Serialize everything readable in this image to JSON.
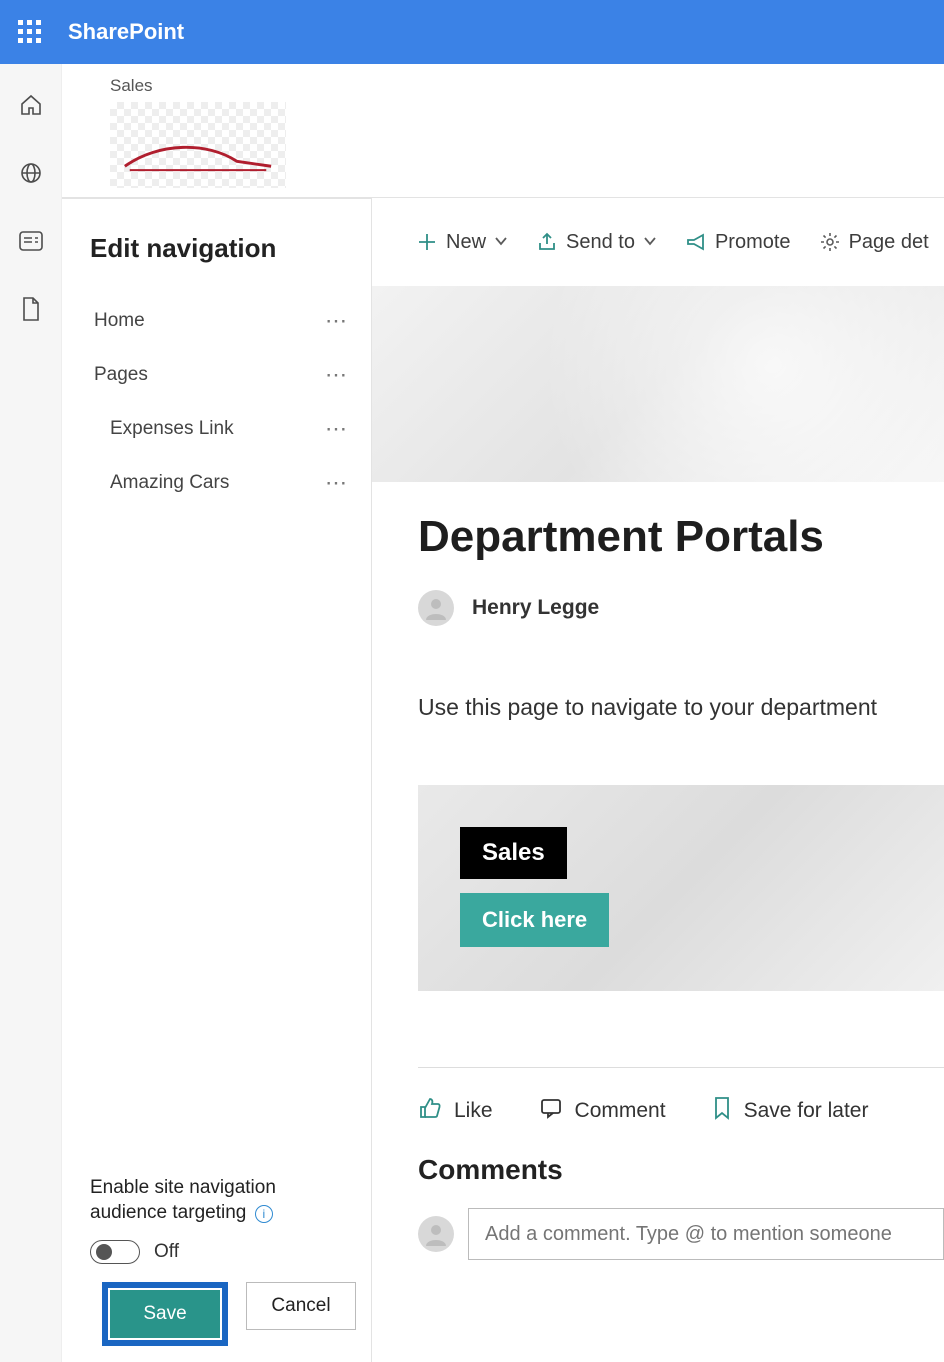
{
  "app_name": "SharePoint",
  "site": {
    "label": "Sales"
  },
  "edit_nav": {
    "title": "Edit navigation",
    "items": [
      {
        "label": "Home",
        "level": 0
      },
      {
        "label": "Pages",
        "level": 0
      },
      {
        "label": "Expenses Link",
        "level": 1
      },
      {
        "label": "Amazing Cars",
        "level": 1
      }
    ],
    "audience": {
      "label_line1": "Enable site navigation",
      "label_line2": "audience targeting",
      "toggle_state": "Off"
    },
    "save_label": "Save",
    "cancel_label": "Cancel"
  },
  "cmd_bar": {
    "new": "New",
    "send_to": "Send to",
    "promote": "Promote",
    "page_details": "Page det"
  },
  "page": {
    "title": "Department Portals",
    "author": "Henry Legge",
    "description": "Use this page to navigate to your department",
    "tile": {
      "label": "Sales",
      "button": "Click here"
    },
    "social": {
      "like": "Like",
      "comment": "Comment",
      "save": "Save for later"
    },
    "comments_heading": "Comments",
    "comment_placeholder": "Add a comment. Type @ to mention someone"
  }
}
